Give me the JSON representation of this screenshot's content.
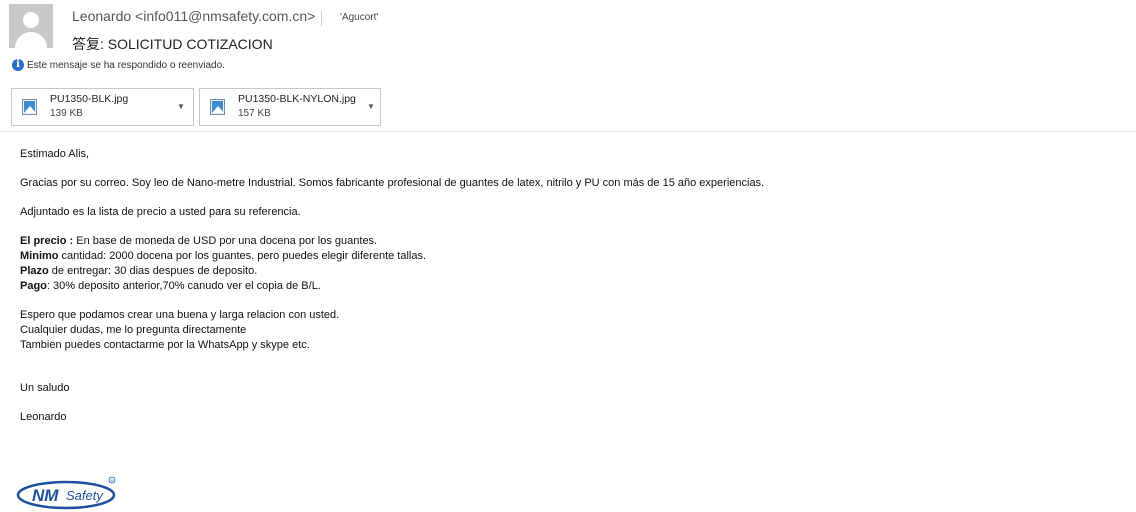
{
  "header": {
    "sender": "Leonardo <info011@nmsafety.com.cn>",
    "recipient": "'Agucort'",
    "subject": "答复: SOLICITUD COTIZACION",
    "info_notice": "Este mensaje se ha respondido o reenviado."
  },
  "attachments": [
    {
      "name": "PU1350-BLK.jpg",
      "size": "139 KB",
      "icon": "image-file-icon"
    },
    {
      "name": "PU1350-BLK-NYLON.jpg",
      "size": "157 KB",
      "icon": "image-file-icon"
    }
  ],
  "body": {
    "greeting": "Estimado Alis,",
    "intro": "Gracias por su correo. Soy leo de Nano-metre Industrial. Somos fabricante profesional de guantes de latex, nitrilo y PU con más de 15 año experiencias.",
    "attach_note": "Adjuntado es la lista de precio a usted para su referencia.",
    "terms": [
      {
        "label": "El precio :",
        "text": " En base de moneda de USD por una docena por los guantes."
      },
      {
        "label": "Minimo",
        "text": " cantidad: 2000 docena por los guantes. pero puedes elegir diferente tallas."
      },
      {
        "label": "Plazo",
        "text": " de entregar: 30 dias despues de deposito."
      },
      {
        "label": "Pago",
        "text": ": 30% deposito anterior,70% canudo ver el copia de B/L."
      }
    ],
    "closing_lines": [
      "Espero que podamos crear una buena y larga relacion con usted.",
      "Cualquier dudas, me lo pregunta directamente",
      "Tambien puedes contactarme por la WhatsApp y skype etc."
    ],
    "regards": "Un saludo",
    "signature": "Leonardo",
    "logo_text": "NMSafety"
  },
  "colors": {
    "info_icon": "#2b6cc4",
    "logo_blue": "#1e4f9c"
  }
}
